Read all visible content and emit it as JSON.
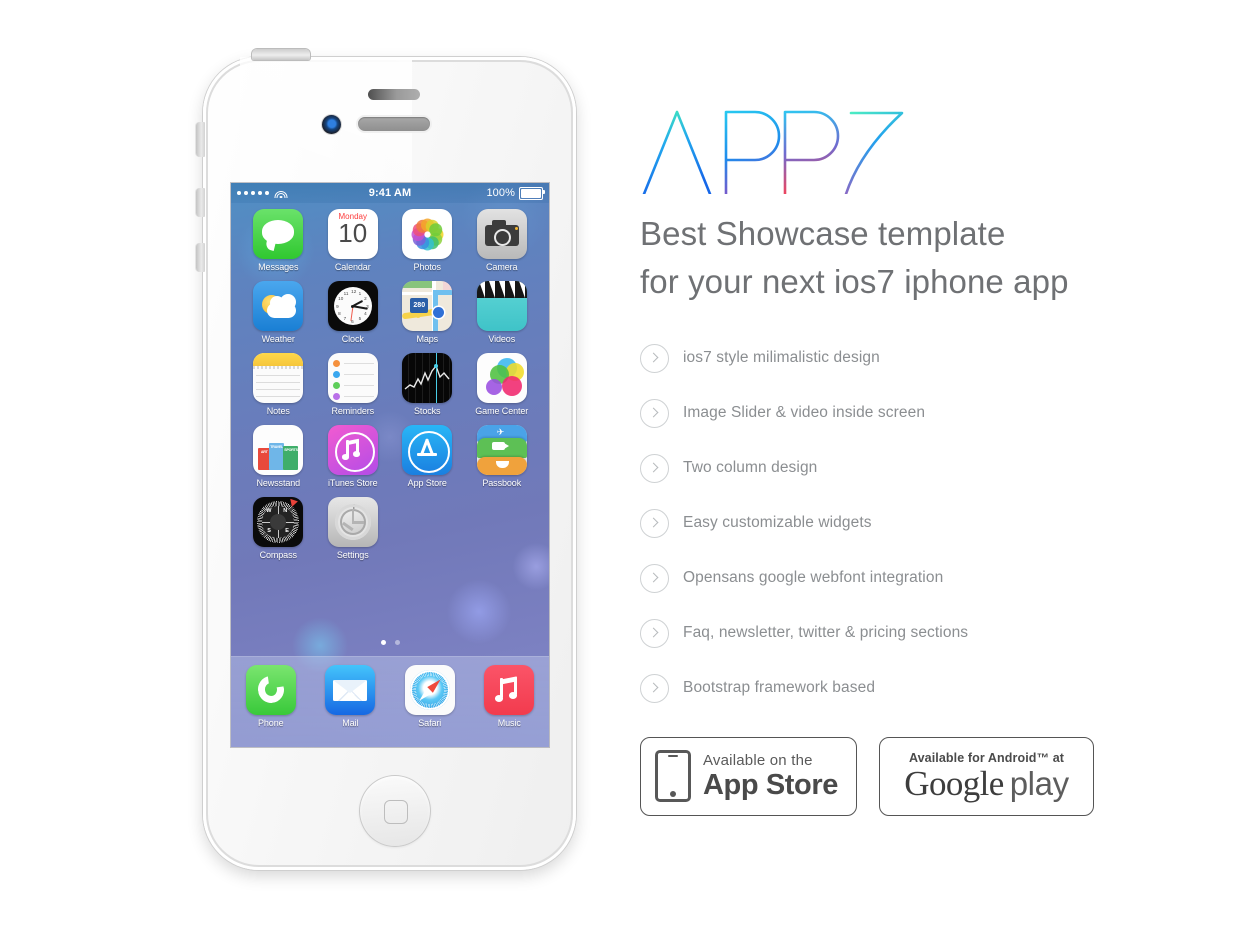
{
  "brand": {
    "logo_text": "APP 7",
    "logo_gradient_from": "#3ee9b4",
    "logo_gradient_mid": "#1f8bec",
    "logo_gradient_to": "#f0445c"
  },
  "headline": {
    "line1": "Best Showcase template",
    "line2": "for your next ios7 iphone app",
    "color": "#6f7174"
  },
  "features": [
    {
      "label": "ios7 style milimalistic design"
    },
    {
      "label": "Image Slider & video inside screen"
    },
    {
      "label": "Two column design"
    },
    {
      "label": "Easy customizable widgets"
    },
    {
      "label": "Opensans google webfont integration"
    },
    {
      "label": "Faq, newsletter, twitter & pricing sections"
    },
    {
      "label": "Bootstrap framework based"
    }
  ],
  "badges": {
    "appstore": {
      "small": "Available on the",
      "big": "App Store"
    },
    "googleplay": {
      "small": "Available for Android™ at",
      "brand": "Google",
      "word": "play"
    }
  },
  "phone": {
    "statusbar": {
      "time": "9:41 AM",
      "battery": "100%",
      "signal_dots": 5
    },
    "pages": {
      "count": 2,
      "active": 1
    },
    "rows": [
      [
        {
          "label": "Messages",
          "icon": "messages-icon"
        },
        {
          "label": "Calendar",
          "icon": "calendar-icon",
          "day": "Monday",
          "date": "10"
        },
        {
          "label": "Photos",
          "icon": "photos-icon"
        },
        {
          "label": "Camera",
          "icon": "camera-icon"
        }
      ],
      [
        {
          "label": "Weather",
          "icon": "weather-icon"
        },
        {
          "label": "Clock",
          "icon": "clock-icon"
        },
        {
          "label": "Maps",
          "icon": "maps-icon",
          "shield": "280"
        },
        {
          "label": "Videos",
          "icon": "videos-icon"
        }
      ],
      [
        {
          "label": "Notes",
          "icon": "notes-icon"
        },
        {
          "label": "Reminders",
          "icon": "reminders-icon"
        },
        {
          "label": "Stocks",
          "icon": "stocks-icon"
        },
        {
          "label": "Game Center",
          "icon": "game-center-icon"
        }
      ],
      [
        {
          "label": "Newsstand",
          "icon": "newsstand-icon",
          "covers": [
            "News",
            "ART",
            "TRAVEL",
            "SPORTS"
          ]
        },
        {
          "label": "iTunes Store",
          "icon": "itunes-store-icon"
        },
        {
          "label": "App Store",
          "icon": "app-store-icon"
        },
        {
          "label": "Passbook",
          "icon": "passbook-icon"
        }
      ],
      [
        {
          "label": "Compass",
          "icon": "compass-icon",
          "marks": [
            "N",
            "E",
            "S",
            "W"
          ]
        },
        {
          "label": "Settings",
          "icon": "settings-icon"
        }
      ]
    ],
    "dock": [
      {
        "label": "Phone",
        "icon": "phone-icon"
      },
      {
        "label": "Mail",
        "icon": "mail-icon"
      },
      {
        "label": "Safari",
        "icon": "safari-icon"
      },
      {
        "label": "Music",
        "icon": "music-icon"
      }
    ],
    "clock_numerals": [
      "12",
      "1",
      "2",
      "3",
      "4",
      "5",
      "6",
      "7",
      "8",
      "9",
      "10",
      "11"
    ]
  }
}
